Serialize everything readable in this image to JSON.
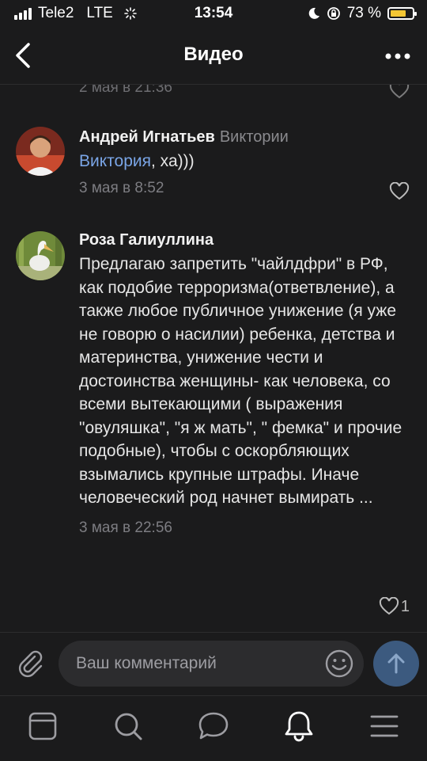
{
  "status_bar": {
    "carrier": "Tele2",
    "network": "LTE",
    "time": "13:54",
    "battery_percent": "73 %",
    "battery_level": 0.73,
    "battery_color": "#f3c634"
  },
  "nav": {
    "title": "Видео",
    "back_icon": "chevron-left-icon",
    "more_icon": "more-horizontal-icon"
  },
  "comments": [
    {
      "timestamp": "2 мая в 21:36",
      "partial": true
    },
    {
      "author": "Андрей Игнатьев",
      "reply_to": "Виктории",
      "mention": "Виктория",
      "text": ", ха)))",
      "timestamp": "3 мая в 8:52",
      "likes": ""
    },
    {
      "author": "Роза Галиуллина",
      "text": "Предлагаю запретить \"чайлдфри\" в РФ, как подобие терроризма(ответвление), а также любое публичное унижение (я уже не говорю о насилии) ребенка, детства и материнства, унижение чести и достоинства женщины- как человека, со всеми вытекающими ( выражения \"овуляшка\", \"я ж мать\", \" фемка\" и прочие подобные), чтобы с оскорбляющих взымались крупные штрафы. Иначе человеческий род начнет вымирать ...",
      "timestamp": "3 мая в 22:56",
      "likes": "1"
    }
  ],
  "input": {
    "placeholder": "Ваш комментарий",
    "attach_icon": "paperclip-icon",
    "emoji_icon": "smile-icon",
    "send_icon": "arrow-up-icon"
  },
  "tabs": [
    {
      "name": "news",
      "icon": "newsfeed-icon"
    },
    {
      "name": "search",
      "icon": "search-icon"
    },
    {
      "name": "messages",
      "icon": "chat-bubble-icon"
    },
    {
      "name": "notifications",
      "icon": "bell-icon"
    },
    {
      "name": "menu",
      "icon": "menu-icon"
    }
  ],
  "colors": {
    "background": "#1b1b1c",
    "mention": "#7aa5e6",
    "send_button": "#3c5a7f"
  }
}
